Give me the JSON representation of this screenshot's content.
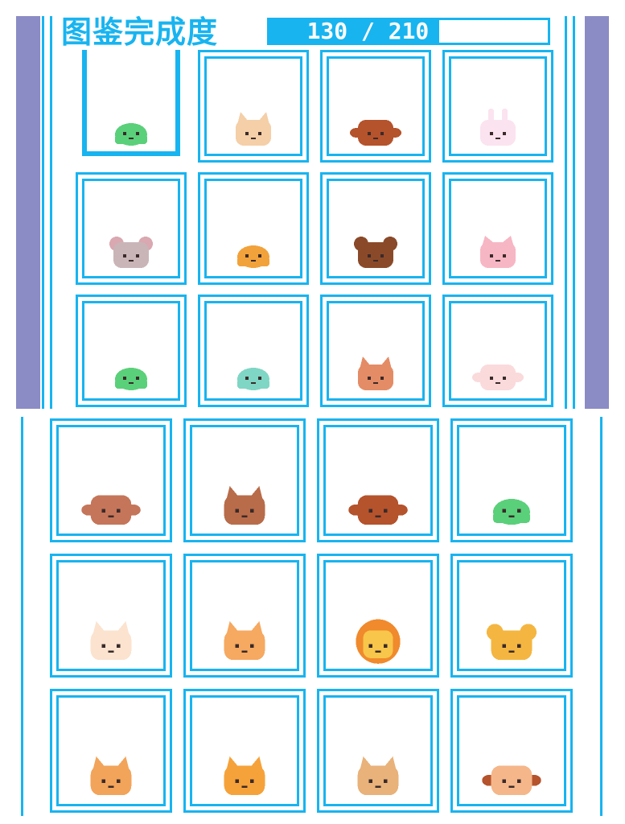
{
  "header": {
    "title": "图鉴完成度",
    "progress_text": "130 / 210 (61%)",
    "progress_fraction": 0.61
  },
  "colors": {
    "accent": "#18b4f0",
    "side": "#8b8bc6"
  },
  "top_grid": [
    {
      "icon": "green-slime-icon",
      "selected": true
    },
    {
      "icon": "cat-face-icon"
    },
    {
      "icon": "monkey-face-icon"
    },
    {
      "icon": "rabbit-face-icon"
    },
    {
      "icon": "mouse-face-icon"
    },
    {
      "icon": "orange-slime-icon"
    },
    {
      "icon": "bear-face-icon"
    },
    {
      "icon": "pig-face-icon"
    },
    {
      "icon": "green-slime-icon"
    },
    {
      "icon": "teal-fish-slime-icon"
    },
    {
      "icon": "deer-face-icon"
    },
    {
      "icon": "sheep-face-icon"
    }
  ],
  "bottom_grid": [
    {
      "icon": "cow-face-icon"
    },
    {
      "icon": "horse-face-icon"
    },
    {
      "icon": "monkey-face-icon"
    },
    {
      "icon": "green-slime-icon"
    },
    {
      "icon": "white-cat-face-icon"
    },
    {
      "icon": "tiger-face-icon"
    },
    {
      "icon": "lion-face-icon"
    },
    {
      "icon": "yellow-bear-face-icon"
    },
    {
      "icon": "fox-face-icon"
    },
    {
      "icon": "orange-tiger-face-icon"
    },
    {
      "icon": "tan-cat-face-icon"
    },
    {
      "icon": "puppy-face-icon"
    }
  ]
}
